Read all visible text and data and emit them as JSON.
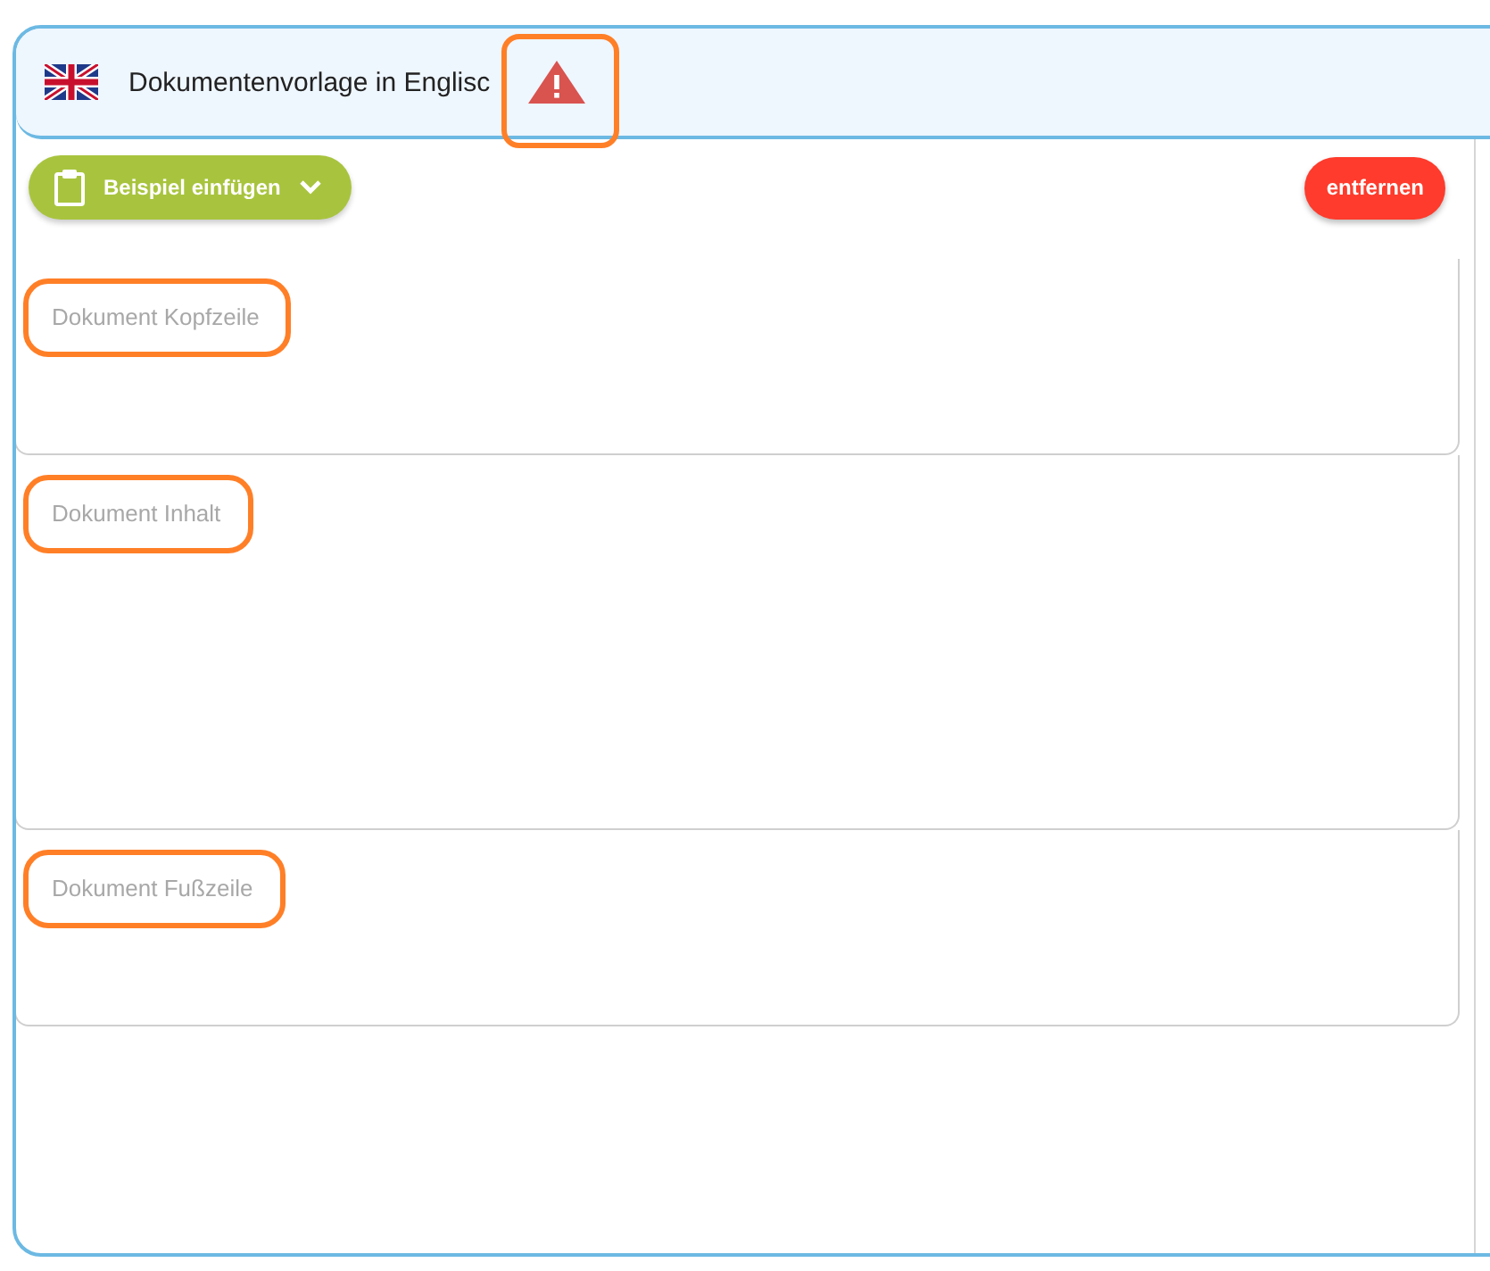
{
  "header": {
    "title": "Dokumentenvorlage in Englisc",
    "warning": {
      "highlighted": true
    }
  },
  "toolbar": {
    "insert_button": {
      "label": "Beispiel einfügen"
    },
    "remove_button": {
      "label": "entfernen"
    }
  },
  "editors": [
    {
      "placeholder": "Dokument Kopfzeile",
      "highlighted": true
    },
    {
      "placeholder": "Dokument Inhalt",
      "highlighted": true
    },
    {
      "placeholder": "Dokument Fußzeile",
      "highlighted": true
    }
  ]
}
